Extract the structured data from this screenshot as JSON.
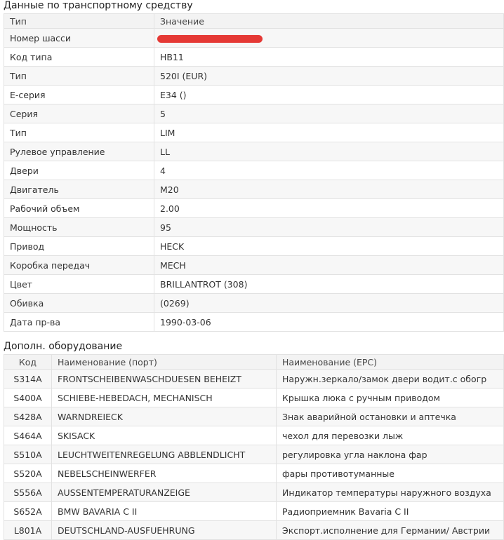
{
  "vehicle_section": {
    "title": "Данные по транспортному средству",
    "headers": [
      "Тип",
      "Значение"
    ],
    "rows": [
      {
        "label": "Номер шасси",
        "value": ""
      },
      {
        "label": "Код типа",
        "value": "HB11"
      },
      {
        "label": "Тип",
        "value": "520I (EUR)"
      },
      {
        "label": "E-серия",
        "value": "E34 ()"
      },
      {
        "label": "Серия",
        "value": "5"
      },
      {
        "label": "Тип",
        "value": "LIM"
      },
      {
        "label": "Рулевое управление",
        "value": "LL"
      },
      {
        "label": "Двери",
        "value": "4"
      },
      {
        "label": "Двигатель",
        "value": "M20"
      },
      {
        "label": "Рабочий объем",
        "value": "2.00"
      },
      {
        "label": "Мощность",
        "value": "95"
      },
      {
        "label": "Привод",
        "value": "HECK"
      },
      {
        "label": "Коробка передач",
        "value": "MECH"
      },
      {
        "label": "Цвет",
        "value": "BRILLANTROT (308)"
      },
      {
        "label": "Обивка",
        "value": " (0269)"
      },
      {
        "label": "Дата пр-ва",
        "value": "1990-03-06"
      }
    ],
    "redaction_color": "#e53935"
  },
  "equipment_section": {
    "title": "Дополн. оборудование",
    "headers": [
      "Код",
      "Наименование (порт)",
      "Наименование (EPC)"
    ],
    "rows": [
      {
        "code": "S314A",
        "name_port": "FRONTSCHEIBENWASCHDUESEN BEHEIZT",
        "name_epc": "Наружн.зеркало/замок двери водит.с обогр"
      },
      {
        "code": "S400A",
        "name_port": "SCHIEBE-HEBEDACH, MECHANISCH",
        "name_epc": "Крышка люка с ручным приводом"
      },
      {
        "code": "S428A",
        "name_port": "WARNDREIECK",
        "name_epc": "Знак аварийной остановки и аптечка"
      },
      {
        "code": "S464A",
        "name_port": "SKISACK",
        "name_epc": "чехол для перевозки лыж"
      },
      {
        "code": "S510A",
        "name_port": "LEUCHTWEITENREGELUNG ABBLENDLICHT",
        "name_epc": "регулировка угла наклона фар"
      },
      {
        "code": "S520A",
        "name_port": "NEBELSCHEINWERFER",
        "name_epc": "фары противотуманные"
      },
      {
        "code": "S556A",
        "name_port": "AUSSENTEMPERATURANZEIGE",
        "name_epc": "Индикатор температуры наружного воздуха"
      },
      {
        "code": "S652A",
        "name_port": "BMW BAVARIA C II",
        "name_epc": "Радиоприемник Bavaria C II"
      },
      {
        "code": "L801A",
        "name_port": "DEUTSCHLAND-AUSFUEHRUNG",
        "name_epc": "Экспорт.исполнение для Германии/ Австрии"
      }
    ]
  }
}
